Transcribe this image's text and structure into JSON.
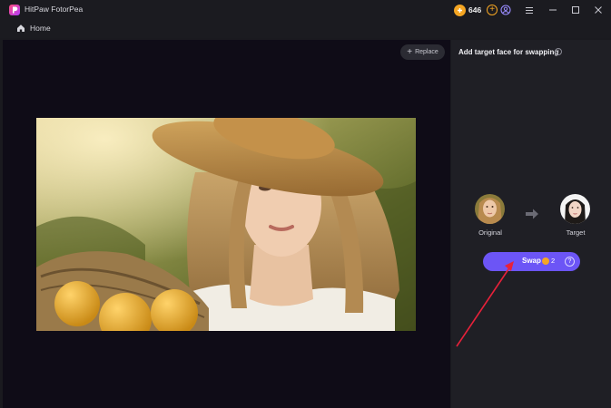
{
  "app": {
    "title": "HitPaw FotorPea"
  },
  "credits": {
    "count": "646"
  },
  "nav": {
    "home_label": "Home"
  },
  "canvas": {
    "replace_label": "Replace"
  },
  "panel": {
    "title": "Add target face for swapping",
    "original_label": "Original",
    "target_label": "Target",
    "swap_label": "Swap",
    "swap_cost": "2"
  },
  "colors": {
    "accent": "#6c55f6",
    "coin": "#f5a623",
    "annotation_arrow": "#e8213a"
  },
  "icons": [
    "app-logo-icon",
    "coin-icon",
    "add-credits-icon",
    "account-icon",
    "menu-icon",
    "minimize-icon",
    "maximize-icon",
    "close-icon",
    "home-icon",
    "plus-icon",
    "info-icon",
    "arrow-right-icon",
    "help-icon"
  ]
}
